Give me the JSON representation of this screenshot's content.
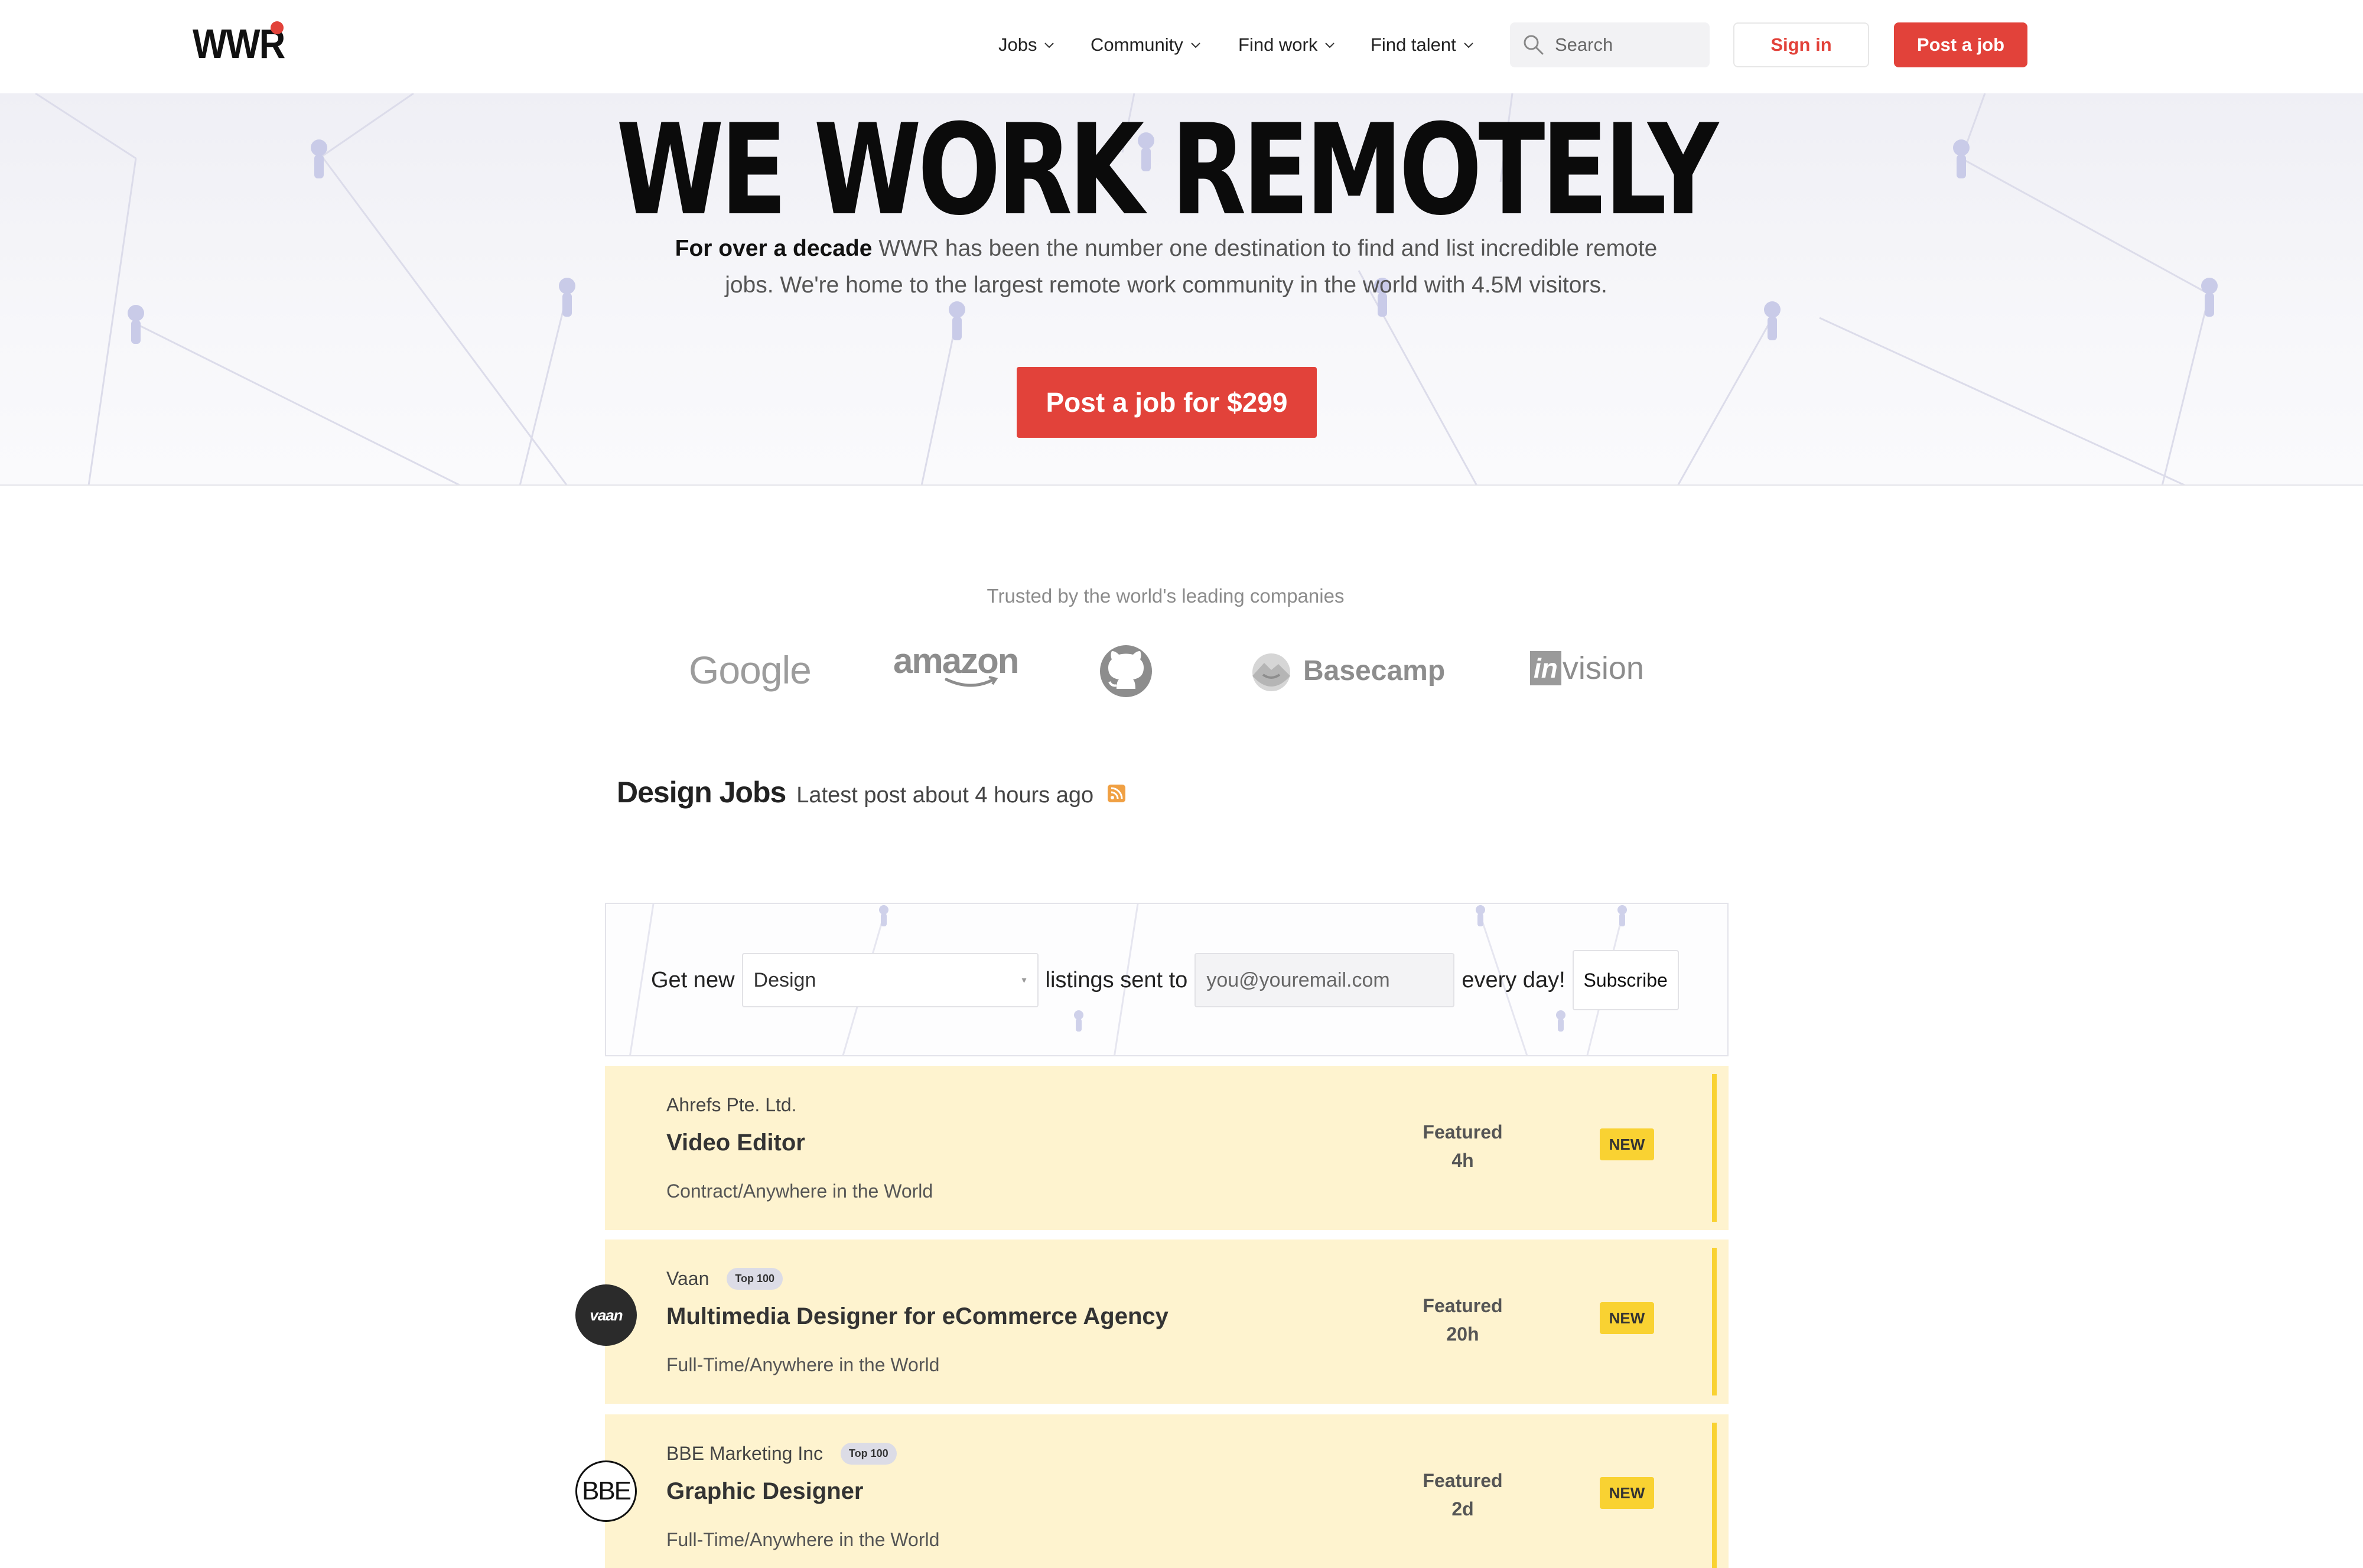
{
  "header": {
    "logo_text": "WWR",
    "nav": [
      {
        "label": "Jobs"
      },
      {
        "label": "Community"
      },
      {
        "label": "Find work"
      },
      {
        "label": "Find talent"
      }
    ],
    "search_placeholder": "Search",
    "sign_in": "Sign in",
    "post_job": "Post a job"
  },
  "hero": {
    "title": "WE WORK REMOTELY",
    "desc_bold": "For over a decade",
    "desc_rest": " WWR has been the number one destination to find and list incredible remote jobs. We're home to the largest remote work community in the world with 4.5M visitors.",
    "cta": "Post a job for $299"
  },
  "trusted": {
    "label": "Trusted by the world's leading companies",
    "companies": [
      "Google",
      "amazon",
      "github-icon",
      "Basecamp",
      "invision"
    ]
  },
  "jobs_section": {
    "title": "Design Jobs",
    "latest": "Latest post about 4 hours ago"
  },
  "subscribe": {
    "prefix": "Get new",
    "category": "Design",
    "middle": "listings sent to",
    "email_placeholder": "you@youremail.com",
    "suffix": "every day!",
    "button": "Subscribe"
  },
  "jobs": [
    {
      "company": "Ahrefs Pte. Ltd.",
      "title": "Video Editor",
      "region": "Contract/Anywhere in the World",
      "featured_label": "Featured",
      "age": "4h",
      "badge": "NEW"
    },
    {
      "company": "Vaan",
      "top_badge": "Top 100",
      "avatar_text": "vaan",
      "title": "Multimedia Designer for eCommerce Agency",
      "region": "Full-Time/Anywhere in the World",
      "featured_label": "Featured",
      "age": "20h",
      "badge": "NEW"
    },
    {
      "company": "BBE Marketing Inc",
      "top_badge": "Top 100",
      "avatar_text": "BBE",
      "title": "Graphic Designer",
      "region": "Full-Time/Anywhere in the World",
      "featured_label": "Featured",
      "age": "2d",
      "badge": "NEW"
    }
  ],
  "colors": {
    "accent": "#e2423a",
    "featured_bg": "#fef3cf",
    "new_badge": "#f9d232"
  }
}
